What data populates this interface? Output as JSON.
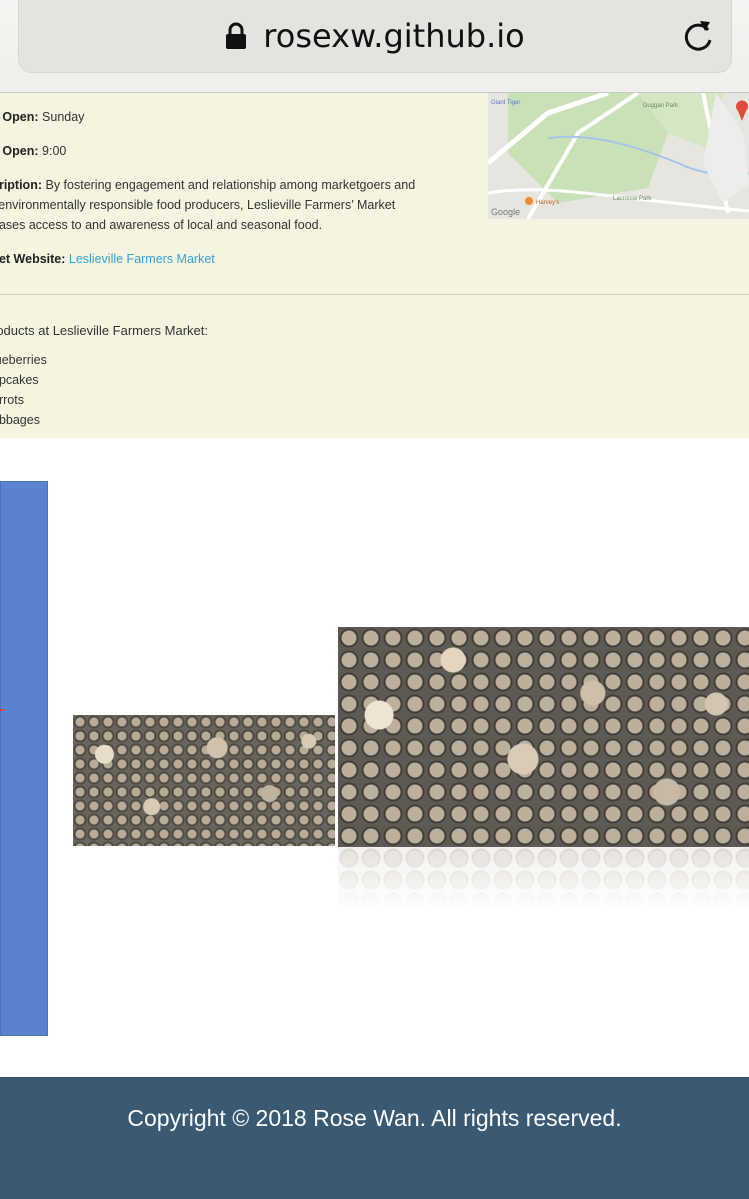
{
  "browser": {
    "url": "rosexw.github.io",
    "lock_icon": "lock-icon",
    "reload_icon": "reload-icon"
  },
  "market": {
    "days_label": "s Open:",
    "days_value": "Sunday",
    "time_label": "e Open:",
    "time_value": "9:00",
    "description_label": "cription:",
    "description_lines": [
      "By fostering engagement and relationship among marketgoers and",
      "l environmentally responsible food producers, Leslieville Farmers’ Market",
      "eases access to and awareness of local and seasonal food."
    ],
    "website_label": "ket Website:",
    "website_link": "Leslieville Farmers Market",
    "products_heading": "roducts at Leslieville Farmers Market:",
    "products": [
      "lueberries",
      "upcakes",
      "arrots",
      "abbages"
    ]
  },
  "map": {
    "labels": {
      "giant_tiger": "Giant Tiger",
      "duggan_park": "Duggan Park",
      "harveys": "Harvey's",
      "lacrosse_park": "Lacrosse Park",
      "google": "Google"
    }
  },
  "footer": {
    "text": "Copyright © 2018 Rose Wan. All rights reserved."
  },
  "colors": {
    "panel_bg": "#f4f4e1",
    "link": "#3aa0d6",
    "blue_block": "#5b82cf",
    "footer_bg": "#3a5a73"
  }
}
